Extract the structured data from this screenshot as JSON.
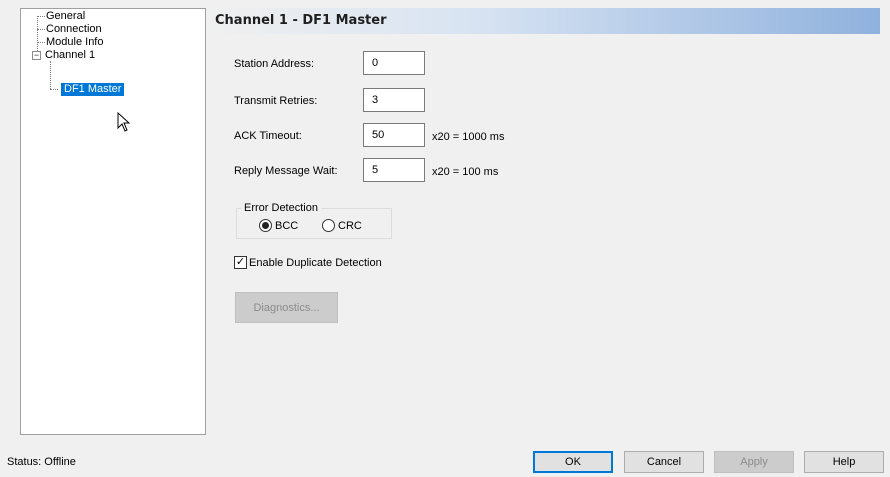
{
  "tree": {
    "items": [
      "General",
      "Connection",
      "Module Info",
      "Channel 1",
      "DF1 Master"
    ],
    "channel_toggle": "−"
  },
  "header": {
    "title": "Channel 1 - DF1 Master"
  },
  "form": {
    "station_address": {
      "label": "Station Address:",
      "value": "0"
    },
    "transmit_retries": {
      "label": "Transmit Retries:",
      "value": "3"
    },
    "ack_timeout": {
      "label": "ACK Timeout:",
      "value": "50",
      "unit": "x20 =  1000 ms"
    },
    "reply_message_wait": {
      "label": "Reply Message Wait:",
      "value": "5",
      "unit": "x20 =  100 ms"
    }
  },
  "error_detection": {
    "legend": "Error Detection",
    "options": [
      "BCC",
      "CRC"
    ],
    "selected": "BCC"
  },
  "duplicate_detection": {
    "label": "Enable Duplicate Detection",
    "checked": true,
    "mark": "✓"
  },
  "diagnostics_button": "Diagnostics...",
  "status": "Status:  Offline",
  "buttons": {
    "ok": "OK",
    "cancel": "Cancel",
    "apply": "Apply",
    "help": "Help"
  }
}
